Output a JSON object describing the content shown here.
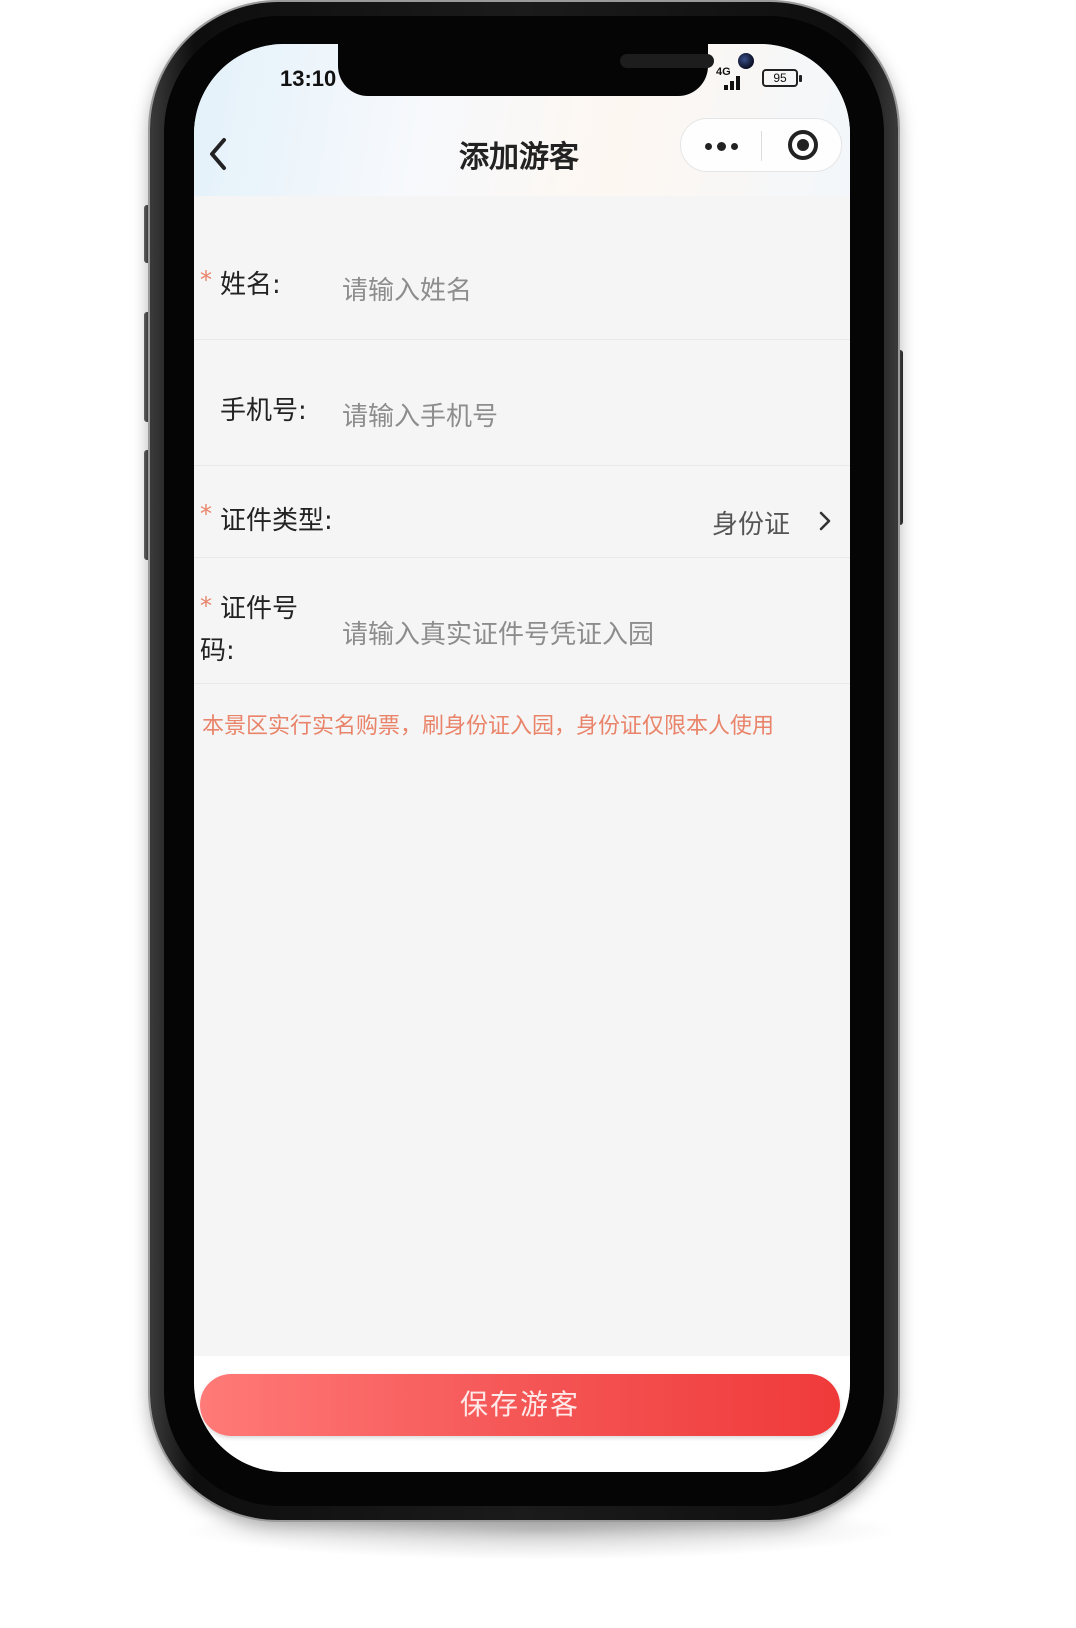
{
  "status_bar": {
    "time": "13:10",
    "network": "4G",
    "battery": "95"
  },
  "nav": {
    "title": "添加游客",
    "back_icon": "chevron-left-icon",
    "more_icon": "more-dots-icon",
    "close_icon": "target-circle-icon"
  },
  "form": {
    "name": {
      "required_mark": "*",
      "label": "姓名:",
      "placeholder": "请输入姓名"
    },
    "phone": {
      "label": "手机号:",
      "placeholder": "请输入手机号"
    },
    "id_type": {
      "required_mark": "*",
      "label": "证件类型:",
      "value": "身份证"
    },
    "id_number": {
      "required_mark": "*",
      "label_line1": "证件号",
      "label_line2": "码:",
      "placeholder": "请输入真实证件号凭证入园"
    }
  },
  "notice": "本景区实行实名购票，刷身份证入园，身份证仅限本人使用",
  "actions": {
    "save_label": "保存游客"
  },
  "colors": {
    "required": "#e9846a",
    "notice": "#e9846a",
    "button_start": "#ff7a78",
    "button_end": "#f03a3a"
  }
}
